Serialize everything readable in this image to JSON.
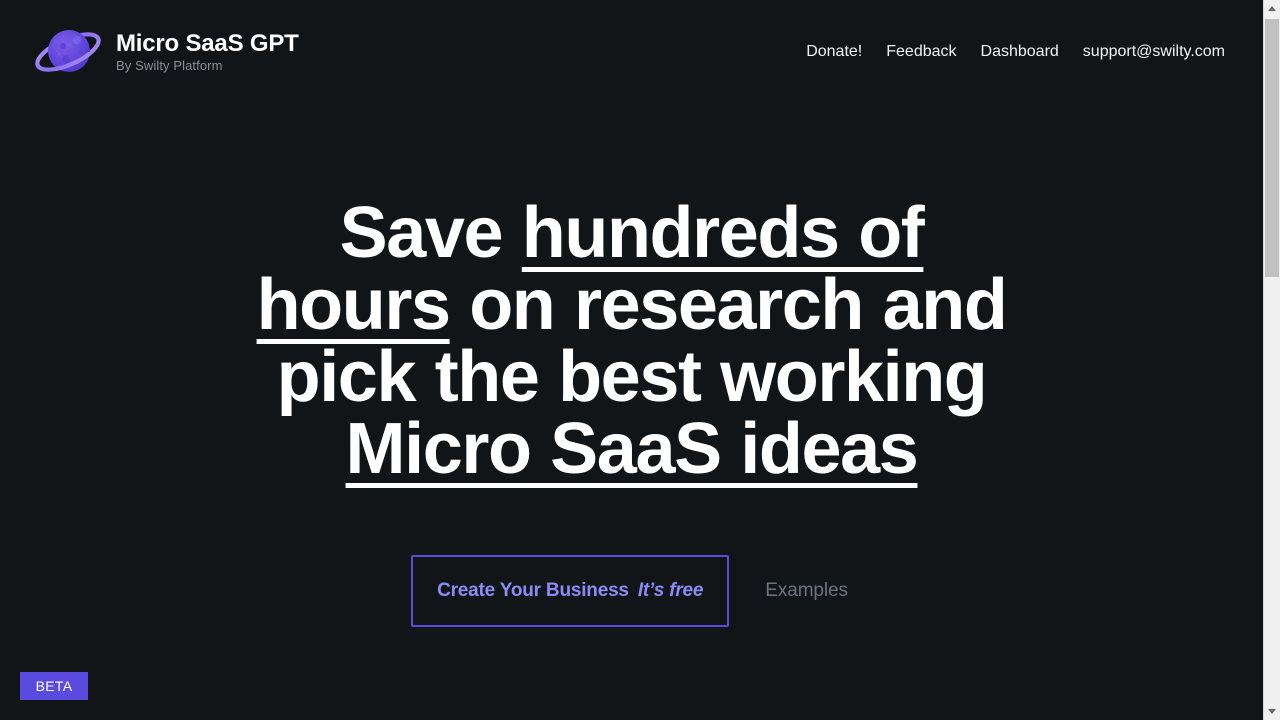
{
  "header": {
    "brand": {
      "title": "Micro SaaS GPT",
      "subtitle": "By Swilty Platform",
      "logo_icon": "planet-icon"
    },
    "nav": [
      {
        "label": "Donate!",
        "name": "nav-link-donate"
      },
      {
        "label": "Feedback",
        "name": "nav-link-feedback"
      },
      {
        "label": "Dashboard",
        "name": "nav-link-dashboard"
      },
      {
        "label": "support@swilty.com",
        "name": "nav-link-support-email"
      }
    ]
  },
  "hero": {
    "headline": {
      "part1": "Save ",
      "emphasis1": "hundreds of hours",
      "part2": " on research and pick the best working ",
      "emphasis2": "Micro SaaS ideas"
    },
    "cta_primary": {
      "label": "Create Your Business",
      "suffix": "It’s free"
    },
    "cta_secondary": {
      "label": "Examples"
    }
  },
  "badge": {
    "beta_label": "BETA"
  },
  "colors": {
    "background": "#111517",
    "accent": "#5b4ae0",
    "accent_text": "#8b8bf5",
    "heading": "#ffffff",
    "muted": "#6b7280",
    "subtitle": "#8a8f94"
  },
  "scrollbar": {
    "up_arrow_icon": "triangle-up-icon",
    "down_arrow_icon": "triangle-down-icon"
  }
}
